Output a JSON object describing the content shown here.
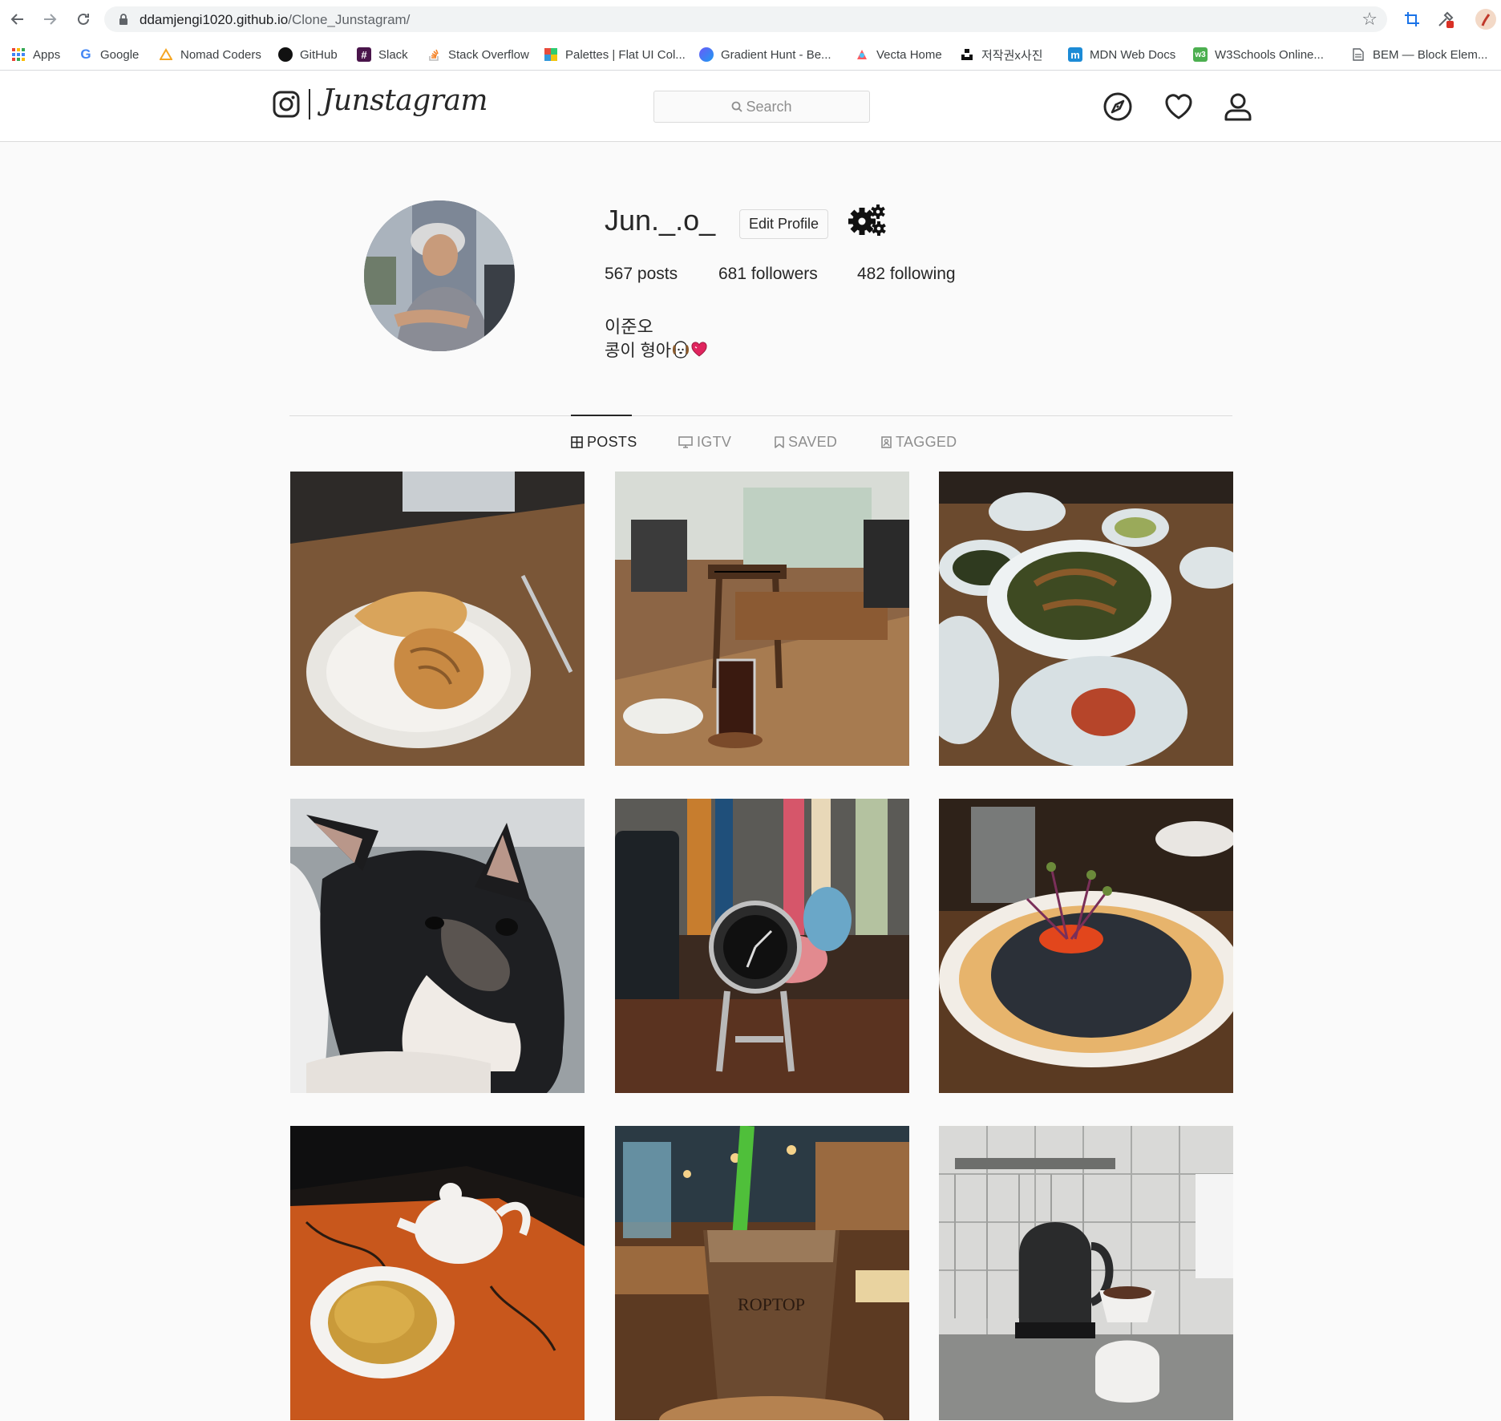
{
  "browser": {
    "url_host": "ddamjengi1020.github.io",
    "url_path": "/Clone_Junstagram/",
    "bookmarks": [
      {
        "label": "Apps",
        "icon": "apps-grid-icon"
      },
      {
        "label": "Google",
        "icon": "google-icon"
      },
      {
        "label": "Nomad Coders",
        "icon": "nomad-coders-icon"
      },
      {
        "label": "GitHub",
        "icon": "github-icon"
      },
      {
        "label": "Slack",
        "icon": "slack-icon"
      },
      {
        "label": "Stack Overflow",
        "icon": "stack-overflow-icon"
      },
      {
        "label": "Palettes | Flat UI Col...",
        "icon": "palettes-icon"
      },
      {
        "label": "Gradient Hunt - Be...",
        "icon": "gradient-hunt-icon"
      },
      {
        "label": "Vecta Home",
        "icon": "vecta-icon"
      },
      {
        "label": "저작권x사진",
        "icon": "unsplash-icon"
      },
      {
        "label": "MDN Web Docs",
        "icon": "mdn-icon"
      },
      {
        "label": "W3Schools Online...",
        "icon": "w3schools-icon"
      },
      {
        "label": "BEM — Block Elem...",
        "icon": "document-icon"
      }
    ]
  },
  "header": {
    "brand": "Junstagram",
    "search_placeholder": "Search",
    "icons": [
      "explore-compass-icon",
      "heart-icon",
      "profile-icon"
    ]
  },
  "profile": {
    "username": "Jun._.o_",
    "edit_button": "Edit Profile",
    "stats": {
      "posts_count": "567",
      "posts_label": "posts",
      "followers_count": "681",
      "followers_label": "followers",
      "following_count": "482",
      "following_label": "following"
    },
    "bio_name": "이준오",
    "bio_text": "콩이 형아"
  },
  "tabs": [
    {
      "label": "POSTS",
      "icon": "grid-icon",
      "active": true
    },
    {
      "label": "IGTV",
      "icon": "tv-icon",
      "active": false
    },
    {
      "label": "SAVED",
      "icon": "bookmark-icon",
      "active": false
    },
    {
      "label": "TAGGED",
      "icon": "tag-icon",
      "active": false
    }
  ],
  "colors": {
    "background": "#fafafa",
    "text": "#262626",
    "muted": "#8e8e8e",
    "border": "#dbdbdb"
  }
}
